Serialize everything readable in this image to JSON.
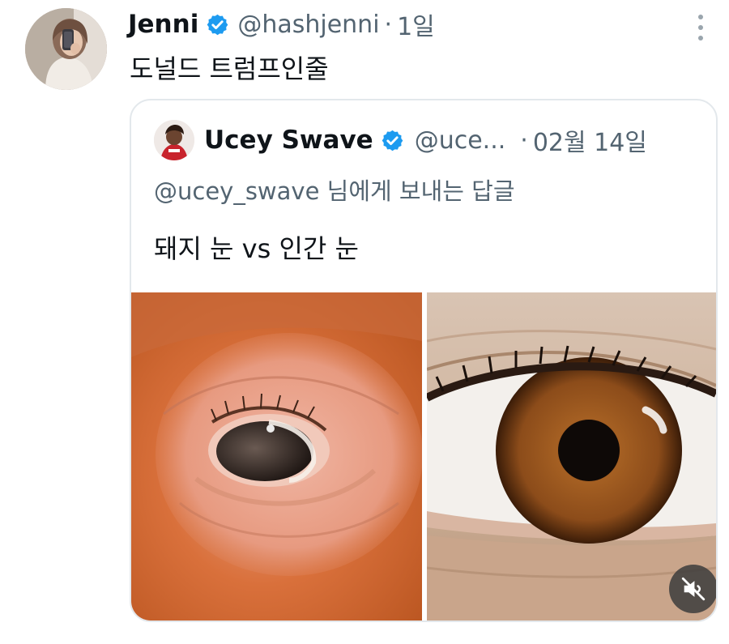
{
  "tweet": {
    "author_name": "Jenni",
    "handle": "@hashjenni",
    "separator": "·",
    "time": "1일",
    "text": "도널드 트럼프인줄",
    "avatar_icon": "profile-photo-icon",
    "more_icon": "more-vertical-icon"
  },
  "quote": {
    "author_name": "Ucey Swave",
    "handle": "@uce...",
    "separator": "·",
    "time": "02월 14일",
    "reply_to": "@ucey_swave 님에게 보내는 답글",
    "text": "돼지 눈 vs 인간 눈",
    "avatar_icon": "profile-photo-icon"
  },
  "media": {
    "left_image_icon": "pig-eye-photo",
    "right_image_icon": "human-eye-photo",
    "mute_icon": "muted-speaker-icon"
  },
  "colors": {
    "verified_badge": "#1d9bf0",
    "secondary_text": "#536471",
    "primary_text": "#0f1419",
    "card_border": "#e3e8ec"
  }
}
